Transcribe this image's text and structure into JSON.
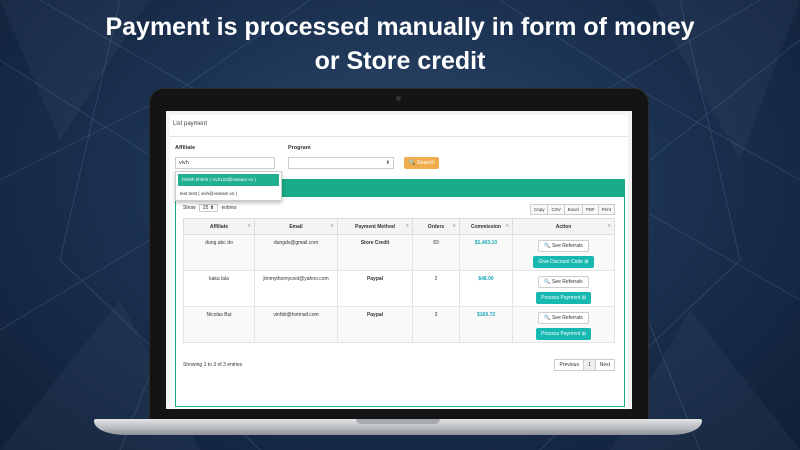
{
  "headline": {
    "line1": "Payment is processed manually in form of money",
    "line2": "or Store credit"
  },
  "page": {
    "title": "List payment"
  },
  "filters": {
    "affiliate_label": "Affiliate",
    "affiliate_value": "vivh",
    "program_label": "Program",
    "program_value": "",
    "search_label": "Search",
    "suggestions": [
      "hhhhh hhhhh ( vivh123@vnteam.vn )",
      "test testt ( vivh@vnteam.vn )"
    ]
  },
  "table_controls": {
    "show_label": "Show",
    "show_value": "25",
    "entries_label": "entries",
    "export_buttons": [
      "Copy",
      "CSV",
      "Excel",
      "PDF",
      "Print"
    ]
  },
  "table": {
    "headers": [
      "Affiliate",
      "Email",
      "Payment Method",
      "Orders",
      "Commission",
      "Action"
    ],
    "rows": [
      {
        "affiliate": "dung abc do",
        "email": "dungdv@gmail.com",
        "method": "Store Credit",
        "orders": "83",
        "commission": "$1,403.10",
        "ref_btn": "See Referrals",
        "action_btn": "Give Discount Code"
      },
      {
        "affiliate": "kaka lala",
        "email": "jimmythomycool@yahoo.com",
        "method": "Paypal",
        "orders": "2",
        "commission": "$48.00",
        "ref_btn": "See Referrals",
        "action_btn": "Process Payment"
      },
      {
        "affiliate": "Nicolas Bui",
        "email": "vinhbt@hotmail.com",
        "method": "Paypal",
        "orders": "3",
        "commission": "$169.72",
        "ref_btn": "See Referrals",
        "action_btn": "Process Payment"
      }
    ]
  },
  "footer": {
    "info": "Showing 1 to 3 of 3 entries",
    "previous": "Previous",
    "page": "1",
    "next": "Next"
  },
  "colors": {
    "accent": "#1aab8a",
    "search_button": "#f0ad4e",
    "commission": "#1aa8b5"
  }
}
